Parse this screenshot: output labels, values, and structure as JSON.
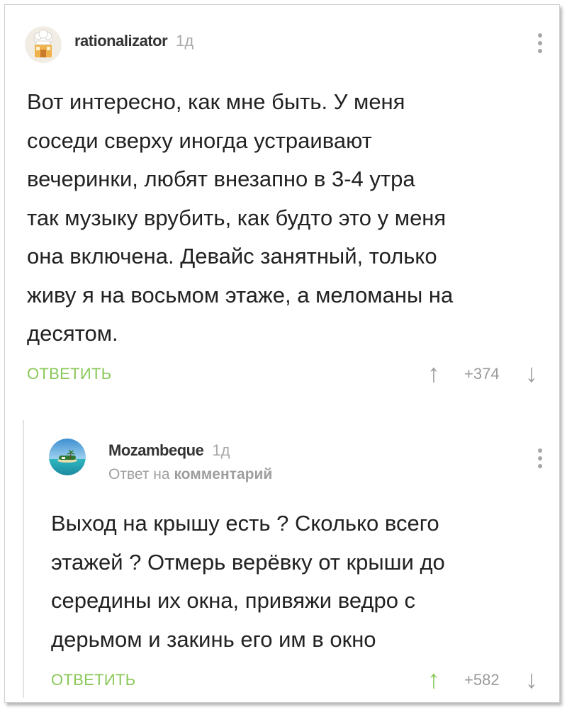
{
  "comments": [
    {
      "author": "rationalizator",
      "age": "1д",
      "avatar_icon": "chef-hat-house-avatar",
      "text_lines": [
        "Вот интересно, как мне быть. У меня",
        "соседи сверху иногда устраивают",
        "вечеринки, любят внезапно в 3-4 утра",
        "так музыку врубить, как будто это у меня",
        "она включена. Девайс занятный, только",
        "живу я на восьмом этаже, а меломаны на",
        "десятом."
      ],
      "reply_label": "ОТВЕТИТЬ",
      "score": "+374",
      "vote_up_icon": "↑",
      "vote_down_icon": "↓"
    },
    {
      "author": "Mozambeque",
      "age": "1д",
      "avatar_icon": "tropical-island-avatar",
      "reply_to_prefix": "Ответ на",
      "reply_to_link": "комментарий",
      "text_lines": [
        "Выход на крышу есть ? Сколько всего",
        "этажей ? Отмерь верёвку от крыши до",
        "середины их окна, привяжи ведро с",
        "дерьмом и закинь его им в окно"
      ],
      "reply_label": "ОТВЕТИТЬ",
      "score": "+582",
      "vote_up_icon": "↑",
      "vote_down_icon": "↓",
      "vote_up_active": true
    }
  ],
  "colors": {
    "accent_green": "#8ac858",
    "muted_gray": "#9b9b9b",
    "thread_line": "#e3e3e3"
  }
}
